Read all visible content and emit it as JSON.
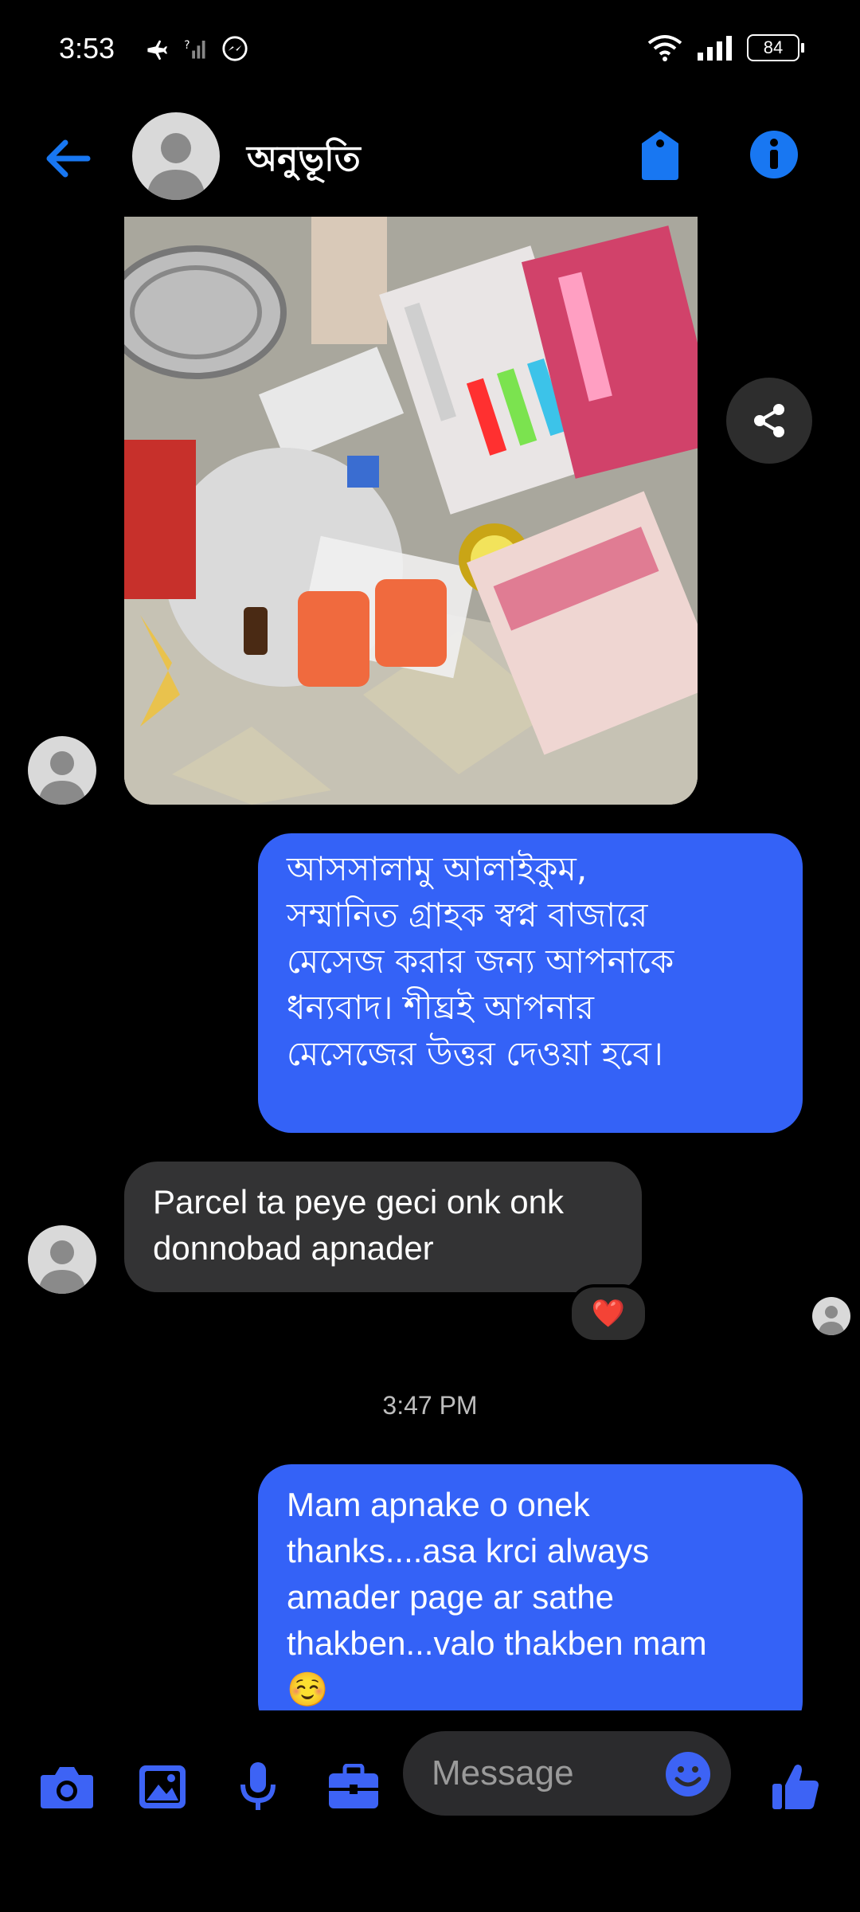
{
  "status_bar": {
    "time": "3:53",
    "battery": "84"
  },
  "header": {
    "contact_name": "অনুভূতি"
  },
  "messages": {
    "outgoing_1": "আসসালামু আলাইকুম,\nসম্মানিত গ্রাহক স্বপ্ন বাজারে\nমেসেজ করার জন্য আপনাকে\nধন্যবাদ। শীঘ্রই আপনার\nমেসেজের উত্তর দেওয়া হবে।",
    "incoming_1": "Parcel ta peye geci onk onk\ndonnobad apnader",
    "reaction": "❤️",
    "timestamp": "3:47 PM",
    "outgoing_2": "Mam apnake o onek\nthanks....asa krci always\namader page ar sathe\nthakben...valo thakben mam\n☺️"
  },
  "composer": {
    "placeholder": "Message"
  },
  "colors": {
    "accent": "#3462f7",
    "icon_blue": "#1877f2",
    "incoming_bubble": "#333334",
    "background": "#000000"
  },
  "icons": [
    "back-arrow-icon",
    "tag-icon",
    "info-icon",
    "share-icon",
    "camera-icon",
    "gallery-icon",
    "microphone-icon",
    "briefcase-icon",
    "emoji-icon",
    "thumbs-up-icon"
  ]
}
